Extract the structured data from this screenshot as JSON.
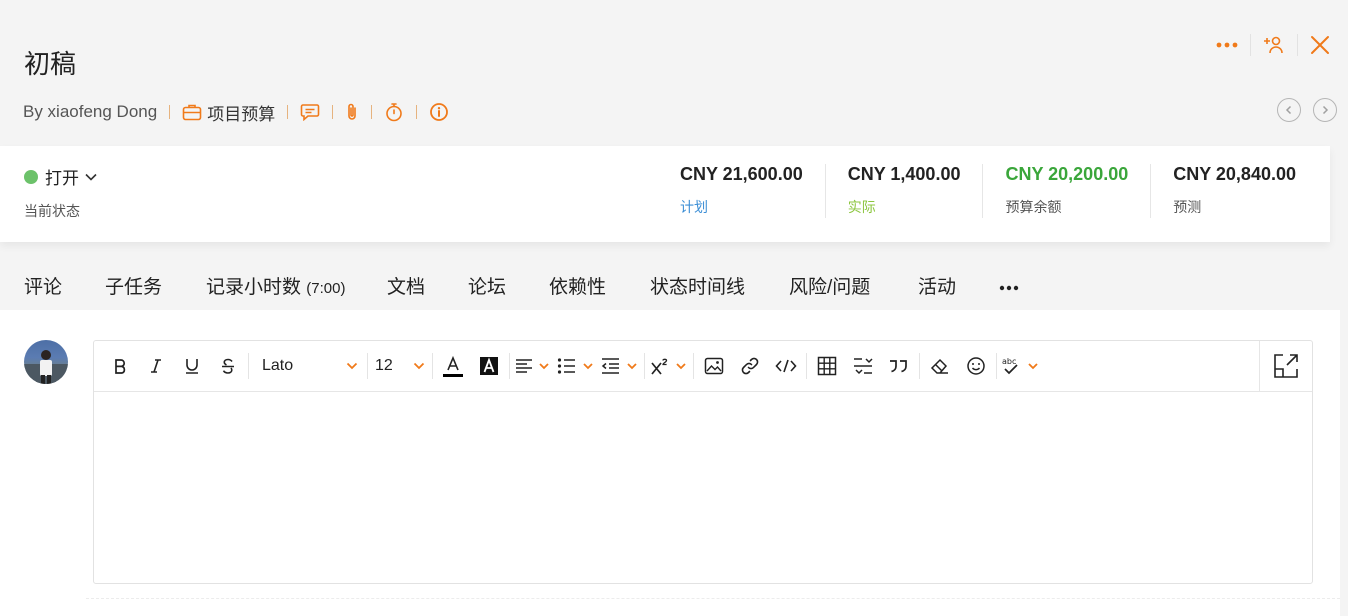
{
  "header": {
    "title": "初稿",
    "author": "By xiaofeng Dong",
    "budget_link": "项目预算"
  },
  "status": {
    "value": "打开",
    "label": "当前状态",
    "dot_color": "#6cc26a"
  },
  "amounts": [
    {
      "value": "CNY 21,600.00",
      "label": "计划",
      "label_color": "#3d8fd6",
      "value_color": "#222222"
    },
    {
      "value": "CNY 1,400.00",
      "label": "实际",
      "label_color": "#8cc63f",
      "value_color": "#222222"
    },
    {
      "value": "CNY 20,200.00",
      "label": "预算余额",
      "label_color": "#555555",
      "value_color": "#3aa63a"
    },
    {
      "value": "CNY 20,840.00",
      "label": "预测",
      "label_color": "#555555",
      "value_color": "#222222"
    }
  ],
  "tabs": [
    {
      "label": "评论"
    },
    {
      "label": "子任务"
    },
    {
      "label": "记录小时数",
      "extra": "(7:00)"
    },
    {
      "label": "文档"
    },
    {
      "label": "论坛"
    },
    {
      "label": "依赖性"
    },
    {
      "label": "状态时间线"
    },
    {
      "label": "风险/问题"
    },
    {
      "label": "活动"
    }
  ],
  "toolbar": {
    "font_family": "Lato",
    "font_size": "12"
  },
  "colors": {
    "accent": "#f07a1a"
  }
}
